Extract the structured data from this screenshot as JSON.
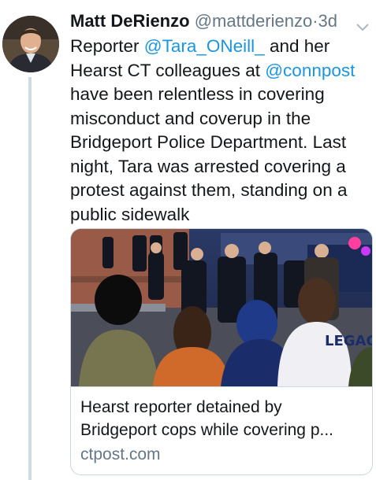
{
  "tweet": {
    "author": {
      "display_name": "Matt DeRienzo",
      "handle": "@mattderienzo",
      "avatar_icon": "user-avatar"
    },
    "separator": "·",
    "time": "3d",
    "menu_icon": "chevron-down-icon",
    "text": {
      "part1": "Reporter ",
      "mention1": "@Tara_ONeill_",
      "part2": " and her Hearst CT colleagues at ",
      "mention2": "@connpost",
      "part3": " have been relentless in covering misconduct and coverup in the Bridgeport Police Department. Last night, Tara was arrested covering a protest against them, standing on a public sidewalk"
    },
    "card": {
      "image_description_icon": "news-photo",
      "sign_text": "LEGACY",
      "title_line1": "Hearst reporter detained by",
      "title_line2": "Bridgeport cops while covering p...",
      "domain": "ctpost.com"
    }
  },
  "colors": {
    "text": "#14171a",
    "secondary": "#657786",
    "link": "#1b95e0",
    "border": "#ccd6dd",
    "thread_line": "#d1dbe3"
  }
}
